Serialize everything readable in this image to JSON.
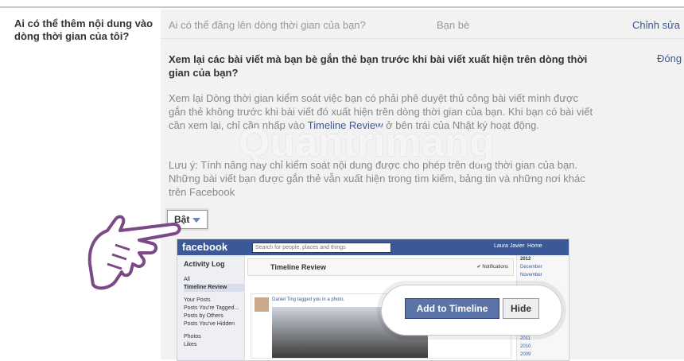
{
  "left_label": "Ai có thể thêm nội dung vào dòng thời gian của tôi?",
  "row1": {
    "question": "Ai có thể đăng lên dòng thời gian của bạn?",
    "audience": "Bạn bè",
    "edit_link": "Chỉnh sửa"
  },
  "review": {
    "title": "Xem lại các bài viết mà bạn bè gắn thẻ bạn trước khi bài viết xuất hiện trên dòng thời gian của bạn?",
    "close_link": "Đóng",
    "desc_before": "Xem lại Dòng thời gian kiểm soát việc bạn có phải phê duyệt thủ công bài viết mình được gắn thẻ không trước khi bài viết đó xuất hiện trên dòng thời gian của bạn. Khi bạn có bài viết cần xem lại, chỉ cần nhấp vào ",
    "desc_link": "Timeline Review",
    "desc_after": " ở bên trái của Nhật ký hoạt động.",
    "note": "Lưu ý: Tính năng này chỉ kiểm soát nội dung được cho phép trên dòng thời gian của bạn. Những bài viết bạn được gắn thẻ vẫn xuất hiện trong tìm kiếm, bảng tin và những nơi khác trên Facebook",
    "toggle_label": "Bật"
  },
  "watermark": "Quantrimang",
  "screenshot": {
    "logo": "facebook",
    "search_placeholder": "Search for people, places and things",
    "user": "Laura Javier",
    "home": "Home",
    "activity_log": "Activity Log",
    "left_items": [
      "All",
      "Timeline Review",
      "Your Posts",
      "Posts You're Tagged...",
      "Posts by Others",
      "Posts You've Hidden",
      "Photos",
      "Likes"
    ],
    "timeline_review": "Timeline Review",
    "notifications": "✔ Notifications",
    "post_text": "Daniel Ting tagged you in a photo.",
    "years": [
      "2012",
      "December",
      "November",
      "2011",
      "2010",
      "2009"
    ],
    "add_button": "Add to Timeline",
    "hide_button": "Hide"
  }
}
